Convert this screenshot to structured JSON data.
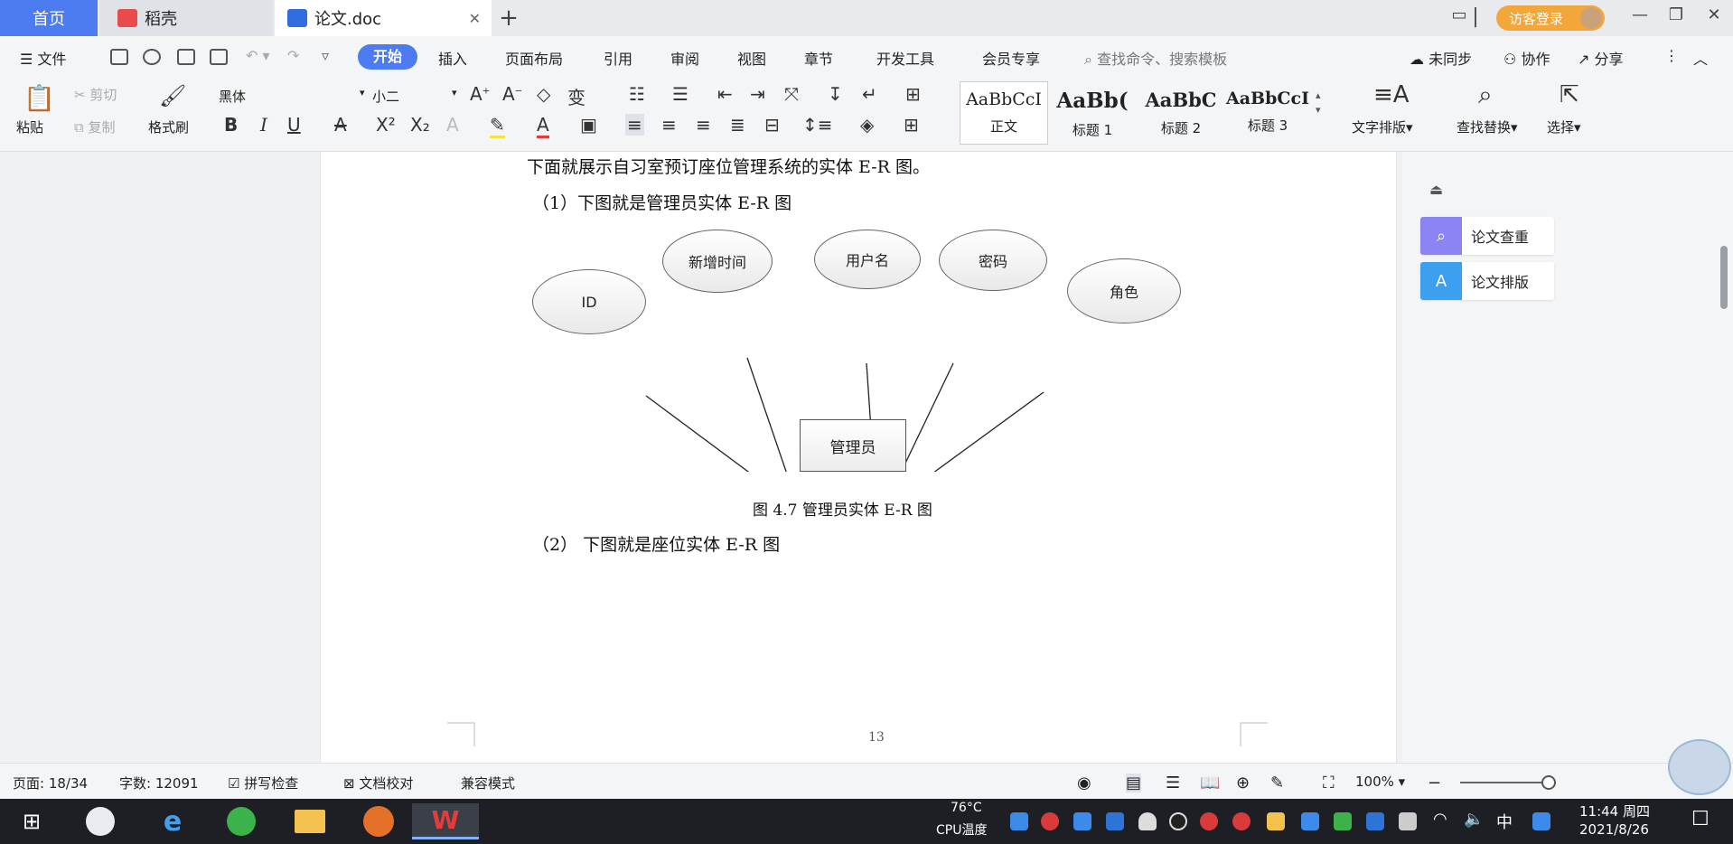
{
  "tabs": {
    "home": "首页",
    "docer": "稻壳",
    "doc": "论文.doc",
    "add": "+"
  },
  "titlebar": {
    "login": "访客登录"
  },
  "menu": {
    "file": "文件",
    "start": "开始",
    "insert": "插入",
    "layout": "页面布局",
    "references": "引用",
    "review": "审阅",
    "view": "视图",
    "section": "章节",
    "developer": "开发工具",
    "member": "会员专享",
    "search_placeholder": "查找命令、搜索模板",
    "sync": "未同步",
    "collab": "协作",
    "share": "分享"
  },
  "ribbon": {
    "paste": "粘贴",
    "cut": "剪切",
    "copy": "复制",
    "format_painter": "格式刷",
    "font_name": "黑体",
    "font_size": "小二",
    "styles": [
      {
        "preview": "AaBbCcI",
        "label": "正文"
      },
      {
        "preview": "AaBb(",
        "label": "标题 1"
      },
      {
        "preview": "AaBbC",
        "label": "标题 2"
      },
      {
        "preview": "AaBbCcI",
        "label": "标题 3"
      }
    ],
    "text_layout": "文字排版",
    "find_replace": "查找替换",
    "select": "选择"
  },
  "document": {
    "line1": "下面就展示自习室预订座位管理系统的实体 E-R 图。",
    "line2": "（1）下图就是管理员实体 E-R 图",
    "caption": "图 4.7  管理员实体 E-R 图",
    "line3": "（2） 下图就是座位实体 E-R 图",
    "page_number": "13",
    "er": {
      "entity": "管理员",
      "attributes": [
        "ID",
        "新增时间",
        "用户名",
        "密码",
        "角色"
      ]
    }
  },
  "right_pane": {
    "plagiarism_check": "论文查重",
    "paper_layout": "论文排版"
  },
  "status": {
    "page": "页面: 18/34",
    "words": "字数: 12091",
    "spellcheck": "拼写检查",
    "proofread": "文档校对",
    "compat": "兼容模式",
    "zoom": "100%"
  },
  "taskbar": {
    "temperature": "76°C",
    "cpu_label": "CPU温度",
    "ime": "中",
    "time": "11:44 周四",
    "date": "2021/8/26"
  },
  "colors": {
    "accent": "#4d7cf0",
    "login": "#f3a63a",
    "taskbar": "#1d1f24"
  }
}
